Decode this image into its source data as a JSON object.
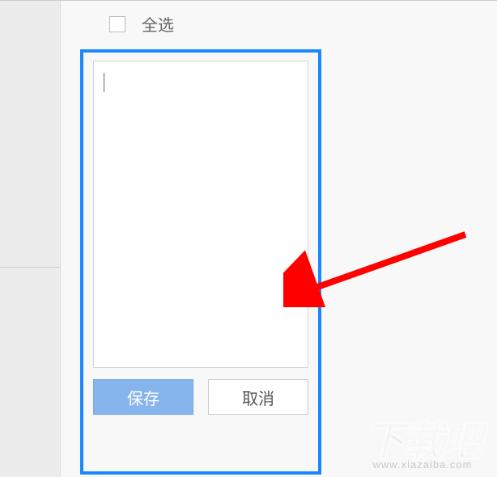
{
  "checkbox": {
    "label": "全选"
  },
  "textarea": {
    "value": ""
  },
  "buttons": {
    "save": "保存",
    "cancel": "取消"
  },
  "watermark": {
    "main": "下载吧",
    "sub": "www.xiazaiba.com"
  }
}
